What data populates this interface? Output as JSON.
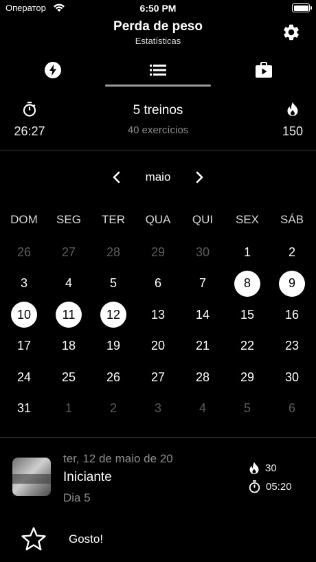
{
  "status_bar": {
    "carrier": "Оператор",
    "time": "6:50 PM"
  },
  "nav": {
    "title": "Perda de peso",
    "subtitle": "Estatísticas"
  },
  "tabs": [
    {
      "icon": "bolt-icon",
      "selected": false
    },
    {
      "icon": "list-icon",
      "selected": true
    },
    {
      "icon": "play-bag-icon",
      "selected": false
    }
  ],
  "summary": {
    "duration": "26:27",
    "workouts": "5 treinos",
    "exercises": "40 exercícios",
    "calories": "150"
  },
  "calendar": {
    "month": "maio",
    "weekdays": [
      "DOM",
      "SEG",
      "TER",
      "QUA",
      "QUI",
      "SEX",
      "SÁB"
    ],
    "weeks": [
      [
        {
          "d": "26",
          "m": true
        },
        {
          "d": "27",
          "m": true
        },
        {
          "d": "28",
          "m": true
        },
        {
          "d": "29",
          "m": true
        },
        {
          "d": "30",
          "m": true
        },
        {
          "d": "1"
        },
        {
          "d": "2"
        }
      ],
      [
        {
          "d": "3"
        },
        {
          "d": "4"
        },
        {
          "d": "5"
        },
        {
          "d": "6"
        },
        {
          "d": "7"
        },
        {
          "d": "8",
          "s": true
        },
        {
          "d": "9",
          "s": true
        }
      ],
      [
        {
          "d": "10",
          "s": true
        },
        {
          "d": "11",
          "s": true
        },
        {
          "d": "12",
          "s": true
        },
        {
          "d": "13"
        },
        {
          "d": "14"
        },
        {
          "d": "15"
        },
        {
          "d": "16"
        }
      ],
      [
        {
          "d": "17"
        },
        {
          "d": "18"
        },
        {
          "d": "19"
        },
        {
          "d": "20"
        },
        {
          "d": "21"
        },
        {
          "d": "22"
        },
        {
          "d": "23"
        }
      ],
      [
        {
          "d": "24"
        },
        {
          "d": "25"
        },
        {
          "d": "26"
        },
        {
          "d": "27"
        },
        {
          "d": "28"
        },
        {
          "d": "29"
        },
        {
          "d": "30"
        }
      ],
      [
        {
          "d": "31"
        },
        {
          "d": "1",
          "m": true
        },
        {
          "d": "2",
          "m": true
        },
        {
          "d": "3",
          "m": true
        },
        {
          "d": "4",
          "m": true
        },
        {
          "d": "5",
          "m": true
        },
        {
          "d": "6",
          "m": true
        }
      ]
    ]
  },
  "workout": {
    "date": "ter, 12 de maio de 20",
    "title": "Iniciante",
    "day": "Dia 5",
    "calories": "30",
    "duration": "05:20"
  },
  "like": {
    "label": "Gosto!"
  },
  "colors": {
    "background": "#000000",
    "muted_text": "#8e8e8e",
    "divider": "#3a3a3a",
    "selected_day": "#ffffff"
  }
}
